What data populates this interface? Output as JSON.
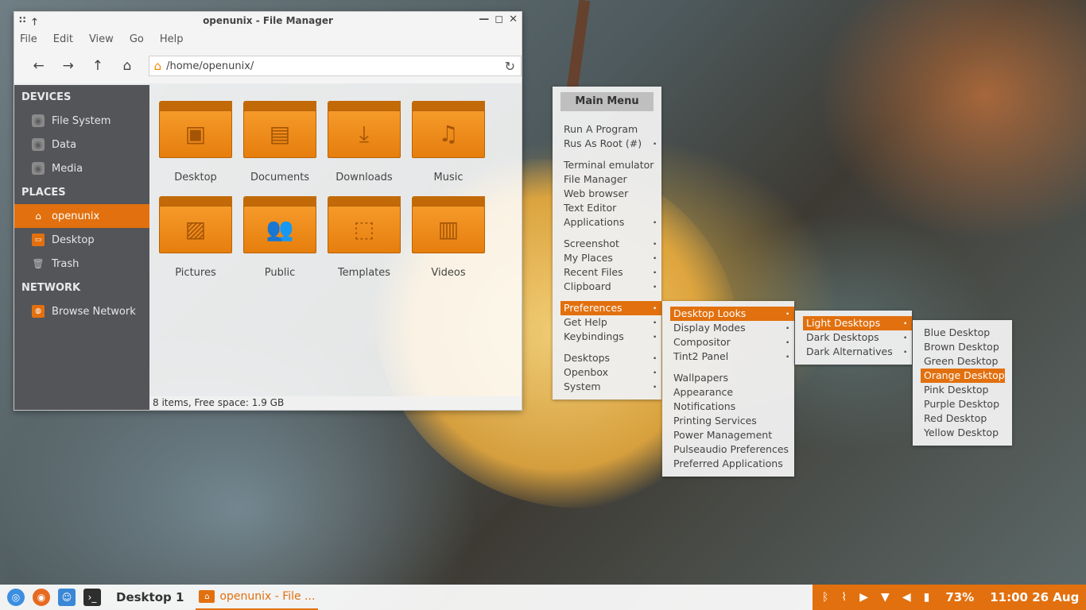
{
  "window": {
    "title": "openunix - File Manager",
    "menu": [
      "File",
      "Edit",
      "View",
      "Go",
      "Help"
    ],
    "path": "/home/openunix/",
    "status": "8 items, Free space: 1.9 GB"
  },
  "sidebar": {
    "devices_header": "DEVICES",
    "devices": [
      "File System",
      "Data",
      "Media"
    ],
    "places_header": "PLACES",
    "places": [
      "openunix",
      "Desktop",
      "Trash"
    ],
    "network_header": "NETWORK",
    "network": [
      "Browse Network"
    ]
  },
  "folders": [
    {
      "label": "Desktop",
      "icon": "desktop-icon"
    },
    {
      "label": "Documents",
      "icon": "document-icon"
    },
    {
      "label": "Downloads",
      "icon": "download-icon"
    },
    {
      "label": "Music",
      "icon": "music-icon"
    },
    {
      "label": "Pictures",
      "icon": "picture-icon"
    },
    {
      "label": "Public",
      "icon": "people-icon"
    },
    {
      "label": "Templates",
      "icon": "template-icon"
    },
    {
      "label": "Videos",
      "icon": "video-icon"
    }
  ],
  "main_menu": {
    "title": "Main Menu",
    "items": [
      "Run A Program",
      "Rus As Root (#)",
      "Terminal emulator",
      "File Manager",
      "Web browser",
      "Text Editor",
      "Applications",
      "Screenshot",
      "My Places",
      "Recent Files",
      "Clipboard",
      "Preferences",
      "Get Help",
      "Keybindings",
      "Desktops",
      "Openbox",
      "System"
    ]
  },
  "prefs_menu": {
    "items": [
      "Desktop Looks",
      "Display Modes",
      "Compositor",
      "Tint2 Panel",
      "Wallpapers",
      "Appearance",
      "Notifications",
      "Printing Services",
      "Power Management",
      "Pulseaudio Preferences",
      "Preferred Applications"
    ]
  },
  "looks_menu": {
    "items": [
      "Light Desktops",
      "Dark Desktops",
      "Dark Alternatives"
    ]
  },
  "light_menu": {
    "items": [
      "Blue Desktop",
      "Brown Desktop",
      "Green Desktop",
      "Orange Desktop",
      "Pink Desktop",
      "Purple Desktop",
      "Red Desktop",
      "Yellow Desktop"
    ]
  },
  "taskbar": {
    "desktop_label": "Desktop 1",
    "task_label": "openunix - File ...",
    "battery": "73%",
    "clock": "11:00 26 Aug"
  },
  "colors": {
    "accent": "#e2700e"
  }
}
